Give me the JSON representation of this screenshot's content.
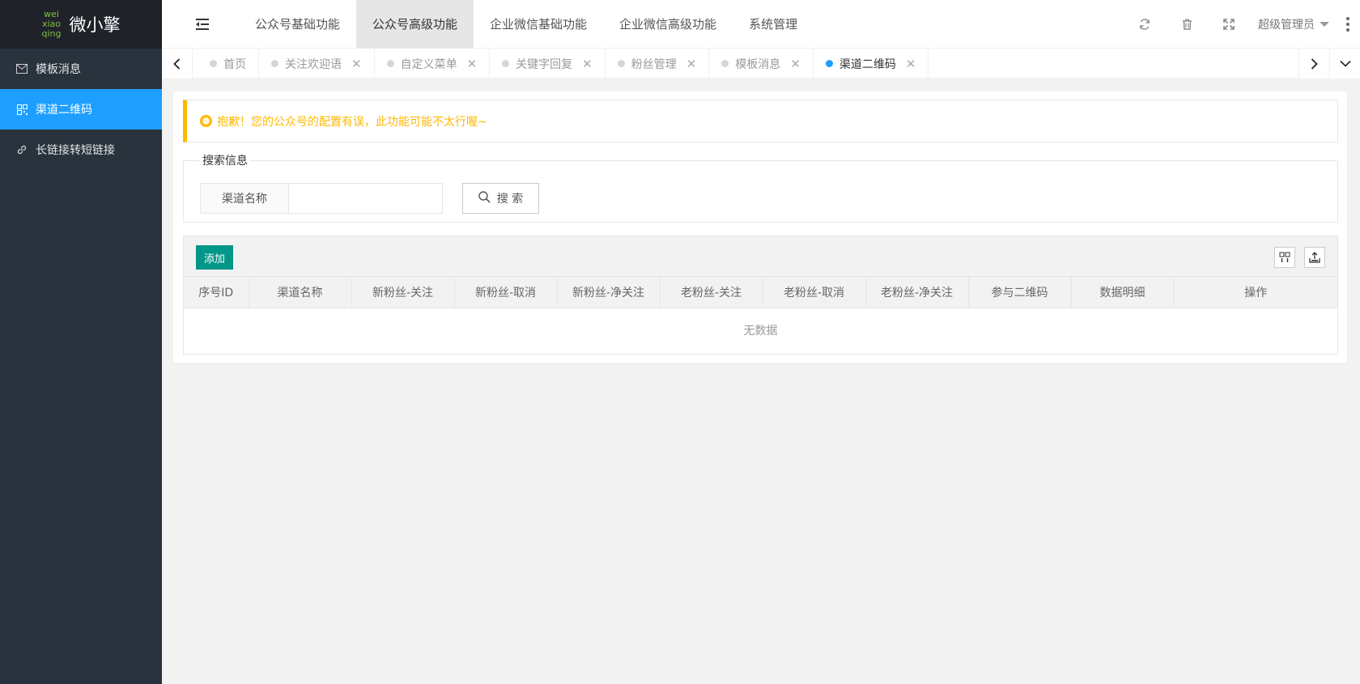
{
  "sidebar": {
    "logo_mark": [
      "wei",
      "xiao",
      "qing"
    ],
    "logo_text": "微小擎",
    "items": [
      {
        "label": "模板消息",
        "icon": "mail-icon",
        "active": false
      },
      {
        "label": "渠道二维码",
        "icon": "qrcode-icon",
        "active": true
      },
      {
        "label": "长链接转短链接",
        "icon": "link-icon",
        "active": false
      }
    ]
  },
  "header": {
    "nav": [
      "公众号基础功能",
      "公众号高级功能",
      "企业微信基础功能",
      "企业微信高级功能",
      "系统管理"
    ],
    "active_nav": 1,
    "user": "超级管理员"
  },
  "tabs": [
    {
      "label": "首页",
      "closable": false,
      "active": false
    },
    {
      "label": "关注欢迎语",
      "closable": true,
      "active": false
    },
    {
      "label": "自定义菜单",
      "closable": true,
      "active": false
    },
    {
      "label": "关键字回复",
      "closable": true,
      "active": false
    },
    {
      "label": "粉丝管理",
      "closable": true,
      "active": false
    },
    {
      "label": "模板消息",
      "closable": true,
      "active": false
    },
    {
      "label": "渠道二维码",
      "closable": true,
      "active": true
    }
  ],
  "alert": {
    "text": "抱歉！您的公众号的配置有误，此功能可能不太行喔~"
  },
  "search": {
    "legend": "搜索信息",
    "field_label": "渠道名称",
    "value": "",
    "placeholder": "",
    "button": "搜 索"
  },
  "table": {
    "add_button": "添加",
    "columns": [
      "序号ID",
      "渠道名称",
      "新粉丝-关注",
      "新粉丝-取消",
      "新粉丝-净关注",
      "老粉丝-关注",
      "老粉丝-取消",
      "老粉丝-净关注",
      "参与二维码",
      "数据明细",
      "操作"
    ],
    "empty_text": "无数据"
  },
  "colors": {
    "accent": "#1e9fff",
    "sidebar": "#28333e",
    "warn": "#ffb800",
    "add": "#009688"
  }
}
